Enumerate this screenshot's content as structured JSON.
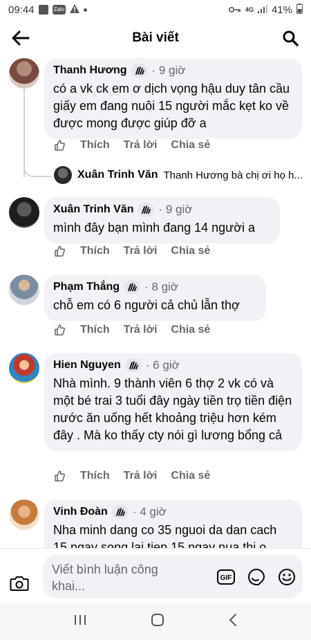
{
  "status_bar": {
    "time": "09:44",
    "network": "4G",
    "battery": "41%"
  },
  "header": {
    "title": "Bài viết"
  },
  "actions": {
    "like": "Thích",
    "reply": "Trả lời",
    "share": "Chia sẻ"
  },
  "comments": [
    {
      "name": "Thanh Hương",
      "time": "· 9 giờ",
      "text": "có a vk ck em ơ dịch vọng hậu duy tân cầu giấy em đang nuôi 15 người mắc kẹt ko về được mong được giúp đỡ a"
    },
    {
      "name": "Xuân Trinh Văn",
      "time": "· 9 giờ",
      "text": "mình đây bạn mình đang 14 người a"
    },
    {
      "name": "Phạm Thắng",
      "time": "· 8 giờ",
      "text": "chỗ em có 6 người cả chủ lẫn thợ"
    },
    {
      "name": "Hien Nguyen",
      "time": "· 6 giờ",
      "text": "Nhà mình. 9 thành viên 6 thợ 2 vk có và một bé trai 3 tuổi đây ngày tiền trọ tiền điện nước ăn uống hết khoảng triệu hơn kém đây . Mà ko thấy cty nói gì lương bổng cả"
    },
    {
      "name": "Vinh Đoàn",
      "time": "· 4 giờ",
      "text": "Nha minh dang co 35 nguoi da dan cach 15 ngay song lai tiep 15 ngay nua thi o"
    }
  ],
  "reply_preview": {
    "name": "Xuân Trinh Văn",
    "text": "Thanh Hương bà chị ơi họ h..."
  },
  "composer": {
    "placeholder": "Viết bình luận công khai...",
    "gif_label": "GIF"
  }
}
